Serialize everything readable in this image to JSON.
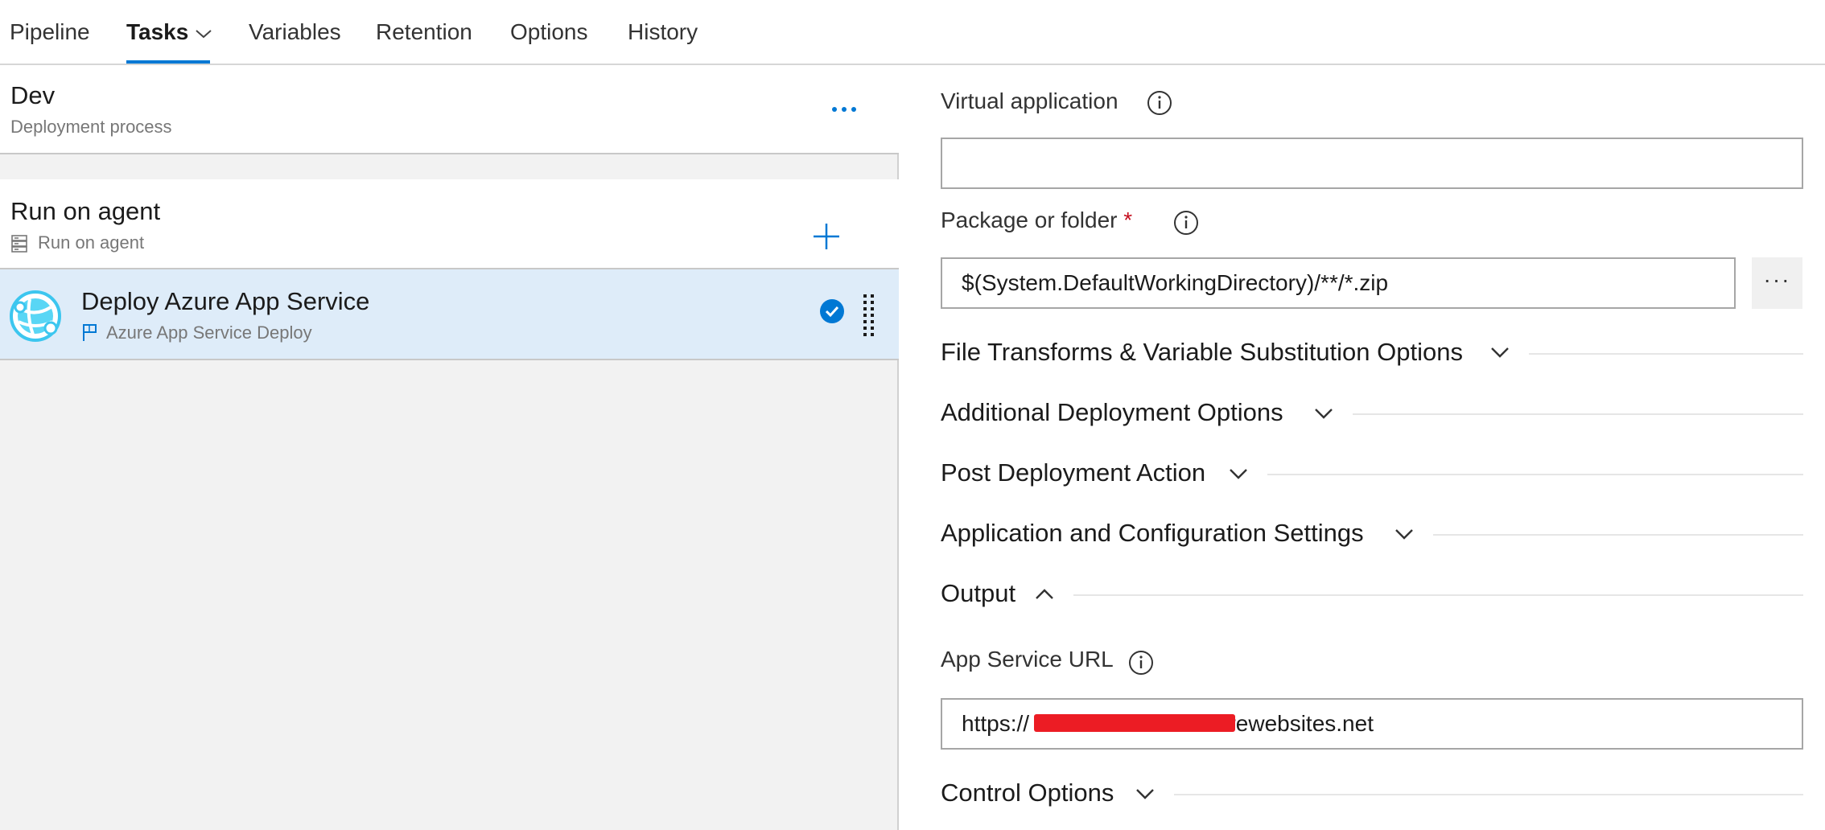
{
  "tabs": {
    "pipeline": "Pipeline",
    "tasks": "Tasks",
    "variables": "Variables",
    "retention": "Retention",
    "options": "Options",
    "history": "History"
  },
  "stage": {
    "title": "Dev",
    "subtitle": "Deployment process"
  },
  "phase": {
    "title": "Run on agent",
    "subtitle": "Run on agent"
  },
  "task": {
    "title": "Deploy Azure App Service",
    "subtitle": "Azure App Service Deploy"
  },
  "form": {
    "virtual_application": {
      "label": "Virtual application",
      "value": ""
    },
    "package_folder": {
      "label": "Package or folder",
      "required_marker": "*",
      "value": "$(System.DefaultWorkingDirectory)/**/*.zip",
      "browse_label": "···"
    },
    "sections": {
      "file_transforms": "File Transforms & Variable Substitution Options",
      "additional_deployment": "Additional Deployment Options",
      "post_deployment": "Post Deployment Action",
      "app_config": "Application and Configuration Settings",
      "output": "Output",
      "control_options": "Control Options"
    },
    "app_service_url": {
      "label": "App Service URL",
      "value": "https://                         .azurewebsites.net"
    }
  },
  "colors": {
    "accent": "#0078d4",
    "selected_row": "#deecf9",
    "required": "#c50f1f",
    "redaction": "#ec1c24"
  }
}
